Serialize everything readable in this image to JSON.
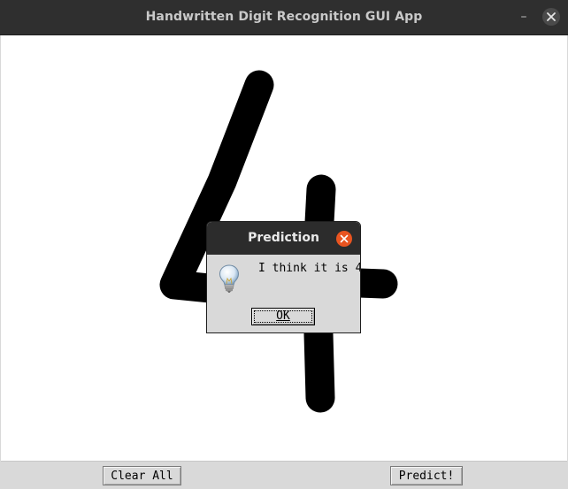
{
  "window": {
    "title": "Handwritten Digit Recognition GUI App",
    "controls": {
      "minimize_glyph": "–",
      "close_icon": "close-icon"
    }
  },
  "canvas": {
    "drawn_digit": "4",
    "stroke_color": "#000000",
    "background_color": "#ffffff"
  },
  "toolbar": {
    "clear_label": "Clear All",
    "predict_label": "Predict!"
  },
  "dialog": {
    "title": "Prediction",
    "icon": "lightbulb-info-icon",
    "message": "I think it is 4",
    "ok_label": "OK",
    "close_color": "#e95420"
  }
}
